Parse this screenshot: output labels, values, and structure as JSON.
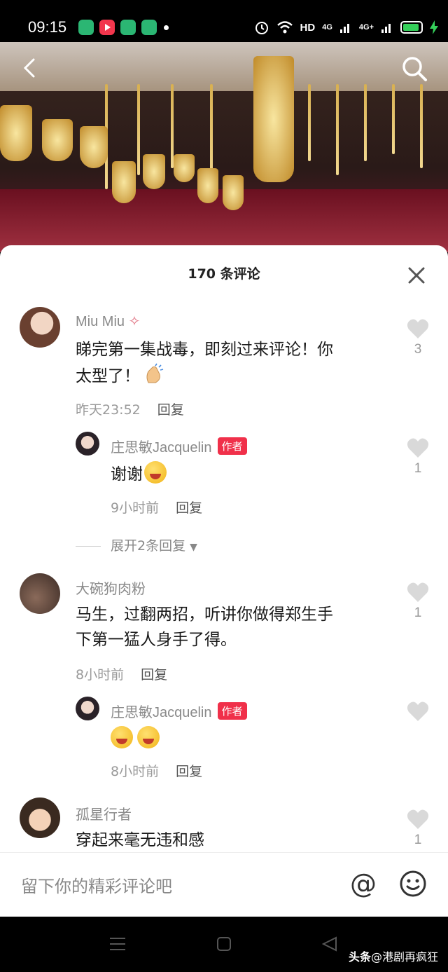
{
  "status_bar": {
    "time": "09:15",
    "network": "HD",
    "sig1": "4G",
    "sig2": "4G+"
  },
  "header": {
    "back_icon": "back-arrow-icon",
    "search_icon": "search-icon"
  },
  "comments_panel": {
    "title": "170 条评论",
    "comments": [
      {
        "user": "Miu Miu",
        "text_lines": [
          "睇完第一集战毒，即刻过来评论！你",
          "太型了！"
        ],
        "time": "昨天23:52",
        "reply_label": "回复",
        "likes": "3"
      },
      {
        "user": "大碗狗肉粉",
        "text_lines": [
          "马生，过翻两招，听讲你做得郑生手",
          "下第一猛人身手了得。"
        ],
        "time": "8小时前",
        "reply_label": "回复",
        "likes": "1"
      },
      {
        "user": "孤星行者",
        "text_lines": [
          "穿起来毫无违和感"
        ],
        "likes": "1"
      }
    ],
    "replies": [
      {
        "user": "庄思敏Jacquelin",
        "tag": "作者",
        "text": "谢谢",
        "time": "9小时前",
        "reply_label": "回复",
        "likes": "1"
      },
      {
        "user": "庄思敏Jacquelin",
        "tag": "作者",
        "text": "",
        "time": "8小时前",
        "reply_label": "回复",
        "likes": ""
      }
    ],
    "expand_label": "展开2条回复"
  },
  "input_bar": {
    "placeholder": "留下你的精彩评论吧",
    "at_symbol": "@"
  },
  "watermark": {
    "brand": "头条",
    "handle": "@港剧再疯狂"
  },
  "colors": {
    "author_tag": "#f0304a",
    "battery": "#35d05a"
  }
}
